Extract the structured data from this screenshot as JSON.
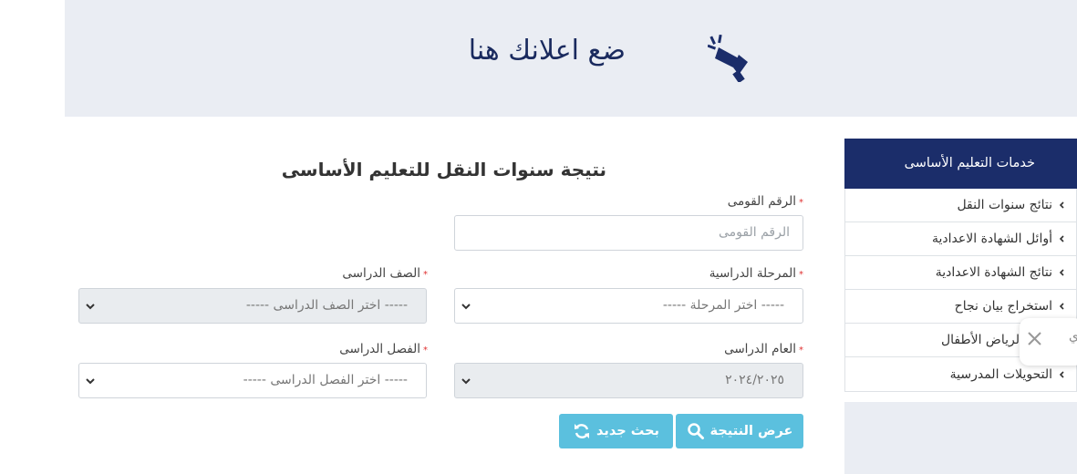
{
  "ad": {
    "text": "ضع اعلانك هنا",
    "icon": "megaphone-icon"
  },
  "form": {
    "title": "نتيجة سنوات النقل للتعليم الأساسى",
    "national_id": {
      "label": "الرقم القومى",
      "placeholder": "الرقم القومى"
    },
    "stage": {
      "label": "المرحلة الدراسية",
      "value": "----- اختر المرحلة -----"
    },
    "grade": {
      "label": "الصف الدراسى",
      "value": "----- اختر الصف الدراسى -----"
    },
    "year": {
      "label": "العام الدراسى",
      "value": "٢٠٢٤/٢٠٢٥"
    },
    "term": {
      "label": "الفصل الدراسى",
      "value": "----- اختر الفصل الدراسى -----"
    },
    "required_mark": "*",
    "show_button": "عرض النتيجة",
    "new_search_button": "بحث جديد"
  },
  "sidebar": {
    "title": "خدمات التعليم الأساسى",
    "items": [
      {
        "label": "نتائج سنوات النقل"
      },
      {
        "label": "أوائل الشهادة الاعدادية"
      },
      {
        "label": "نتائج الشهادة الاعدادية"
      },
      {
        "label": "استخراج بيان نجاح"
      },
      {
        "label": "تقديم لرياض الأطفال"
      },
      {
        "label": "التحويلات المدرسية"
      }
    ]
  },
  "toast": {
    "char": "ي"
  },
  "colors": {
    "navy": "#1b2d6a",
    "accent": "#5bc0de",
    "banner": "#eaedf3",
    "required": "#e03131"
  }
}
